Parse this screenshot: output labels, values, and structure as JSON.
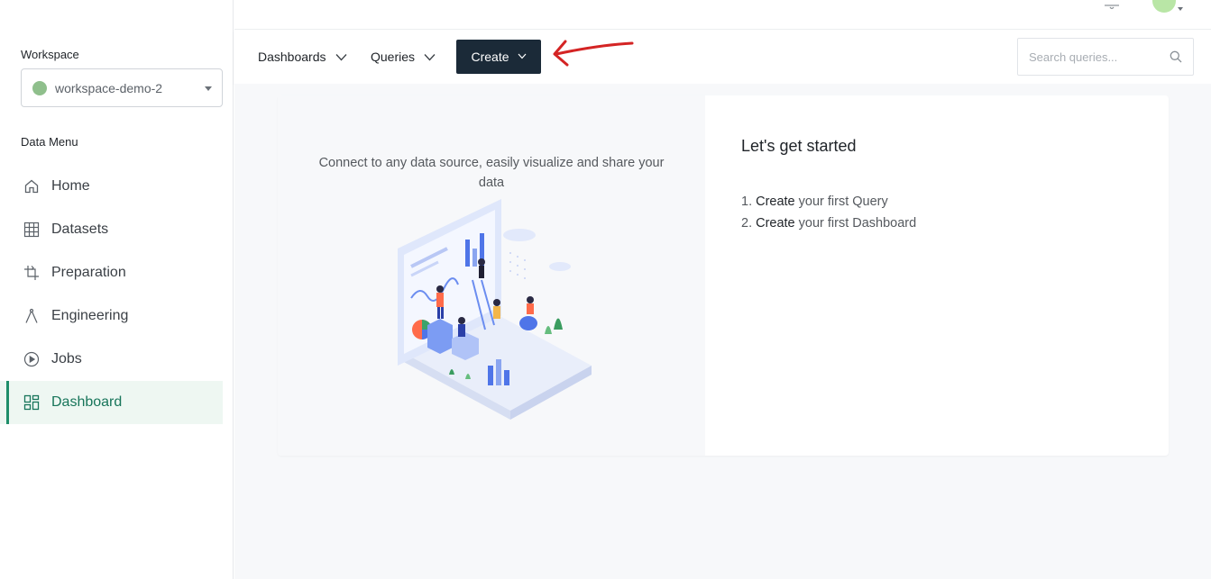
{
  "sidebar": {
    "workspace_label": "Workspace",
    "workspace_value": "workspace-demo-2",
    "workspace_dot_color": "#8fbf8c",
    "menu_label": "Data Menu",
    "items": [
      {
        "label": "Home",
        "icon": "home-icon"
      },
      {
        "label": "Datasets",
        "icon": "grid-icon"
      },
      {
        "label": "Preparation",
        "icon": "crop-icon"
      },
      {
        "label": "Engineering",
        "icon": "compass-icon"
      },
      {
        "label": "Jobs",
        "icon": "play-circle-icon"
      },
      {
        "label": "Dashboard",
        "icon": "dashboard-icon",
        "active": true
      }
    ],
    "active_color": "#1e8e6a"
  },
  "toolbar": {
    "dashboards_label": "Dashboards",
    "queries_label": "Queries",
    "create_label": "Create",
    "create_bg": "#1b2a38",
    "search_placeholder": "Search queries...",
    "annotation_arrow_color": "#d42424"
  },
  "main": {
    "connect_text": "Connect to any data source, easily visualize and share your data",
    "start_title": "Let's get started",
    "steps": [
      {
        "num": "1.",
        "action": "Create",
        "rest": "your first Query"
      },
      {
        "num": "2.",
        "action": "Create",
        "rest": "your first Dashboard"
      }
    ]
  }
}
